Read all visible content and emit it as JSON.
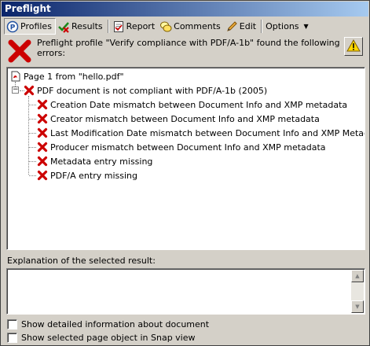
{
  "window": {
    "title": "Preflight"
  },
  "toolbar": {
    "profiles": "Profiles",
    "results": "Results",
    "report": "Report",
    "comments": "Comments",
    "edit": "Edit",
    "options": "Options",
    "options_caret": "▼"
  },
  "header": {
    "message": "Preflight profile \"Verify compliance with PDF/A-1b\" found the following errors:"
  },
  "tree": {
    "expander_symbol": "−",
    "page": "Page 1 from \"hello.pdf\"",
    "root_error": "PDF document is not compliant with PDF/A-1b (2005)",
    "errors": [
      "Creation Date mismatch between Document Info and XMP metadata",
      "Creator mismatch between Document Info and XMP metadata",
      "Last Modification Date mismatch between Document Info and XMP Metadata",
      "Producer mismatch between Document Info and XMP metadata",
      "Metadata entry missing",
      "PDF/A entry missing"
    ]
  },
  "explanation": {
    "label": "Explanation of the selected result:",
    "value": ""
  },
  "options": {
    "show_detailed": "Show detailed information about document",
    "show_snap": "Show selected page object in Snap view"
  },
  "colors": {
    "title_start": "#0a246a",
    "title_end": "#a6caf0",
    "error_red": "#cc0000",
    "face": "#d4d0c8"
  }
}
